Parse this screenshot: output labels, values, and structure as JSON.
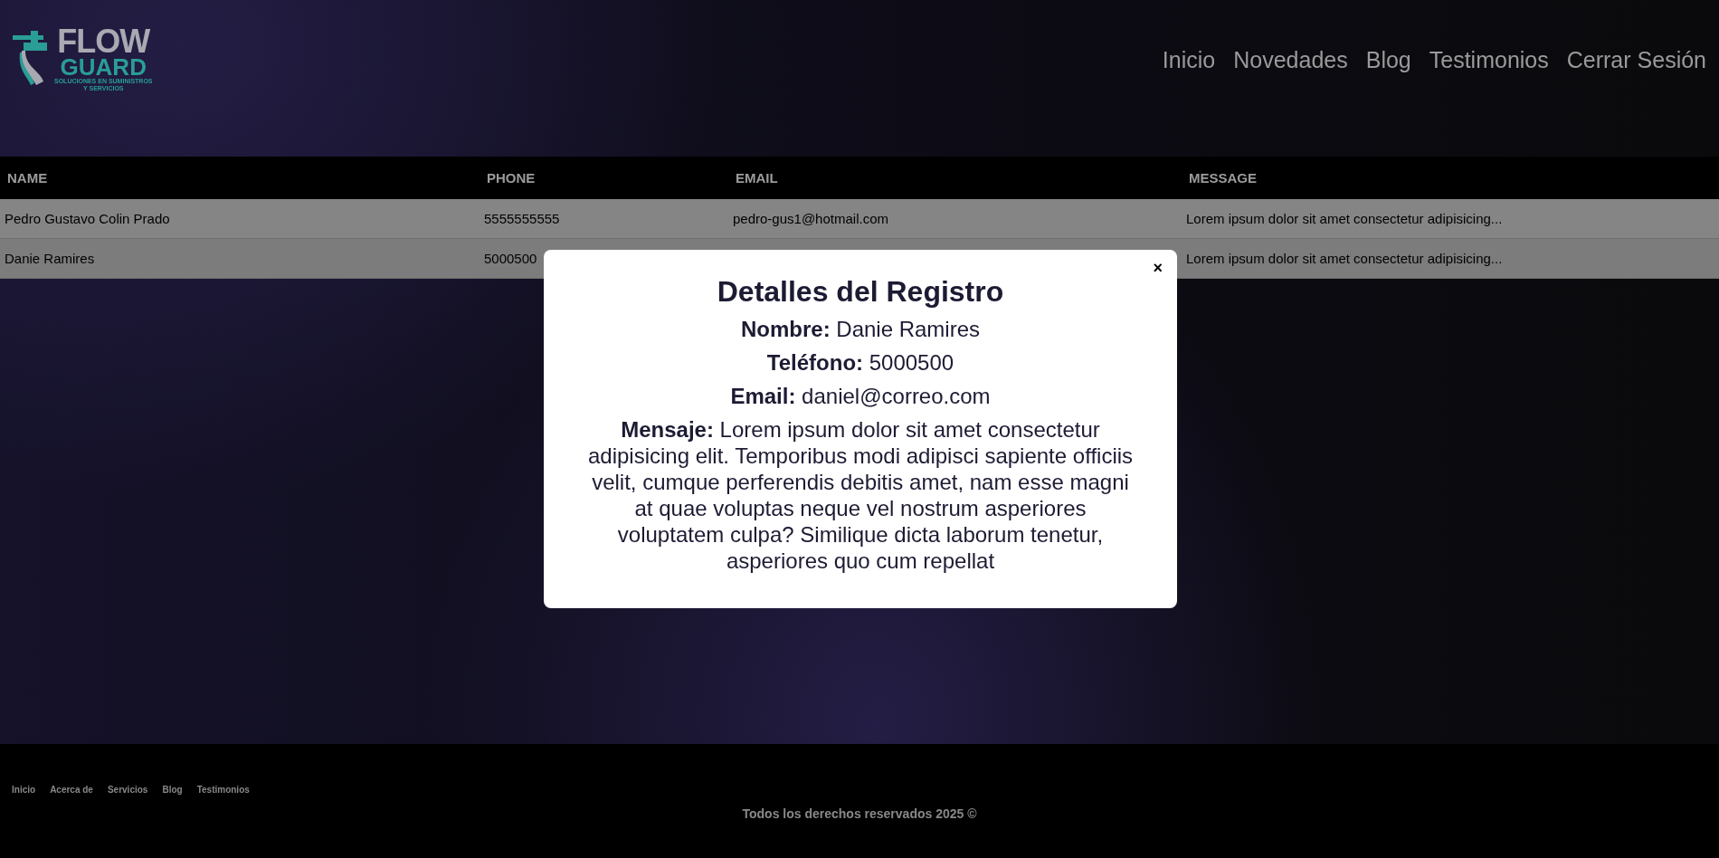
{
  "logo": {
    "line_1": "FLOW",
    "line_2": "GUARD",
    "tagline_1": "SOLUCIONES EN SUMINISTROS",
    "tagline_2": "Y SERVICIOS"
  },
  "nav": [
    "Inicio",
    "Novedades",
    "Blog",
    "Testimonios",
    "Cerrar Sesión"
  ],
  "table": {
    "columns": [
      "NAME",
      "PHONE",
      "EMAIL",
      "MESSAGE"
    ],
    "rows": [
      {
        "name": "Pedro Gustavo Colin Prado",
        "phone": "5555555555",
        "email": "pedro-gus1@hotmail.com",
        "message": "Lorem ipsum dolor sit amet consectetur adipisicing..."
      },
      {
        "name": "Danie Ramires",
        "phone": "5000500",
        "message": "Lorem ipsum dolor sit amet consectetur adipisicing..."
      }
    ]
  },
  "modal": {
    "title": "Detalles del Registro",
    "close": "×",
    "fields": [
      {
        "label": "Nombre:",
        "value": "Danie Ramires"
      },
      {
        "label": "Teléfono:",
        "value": "5000500"
      },
      {
        "label": "Email:",
        "value": "daniel@correo.com"
      },
      {
        "label": "Mensaje:",
        "value": "Lorem ipsum dolor sit amet consectetur adipisicing elit. Temporibus modi adipisci sapiente officiis velit, cumque perferendis debitis amet, nam esse magni at quae voluptas neque vel nostrum asperiores voluptatem culpa? Similique dicta laborum tenetur, asperiores quo cum repellat"
      }
    ]
  },
  "footer": {
    "links": [
      "Inicio",
      "Acerca de",
      "Servicios",
      "Blog",
      "Testimonios"
    ],
    "copyright": "Todos los derechos reservados 2025 ©"
  }
}
